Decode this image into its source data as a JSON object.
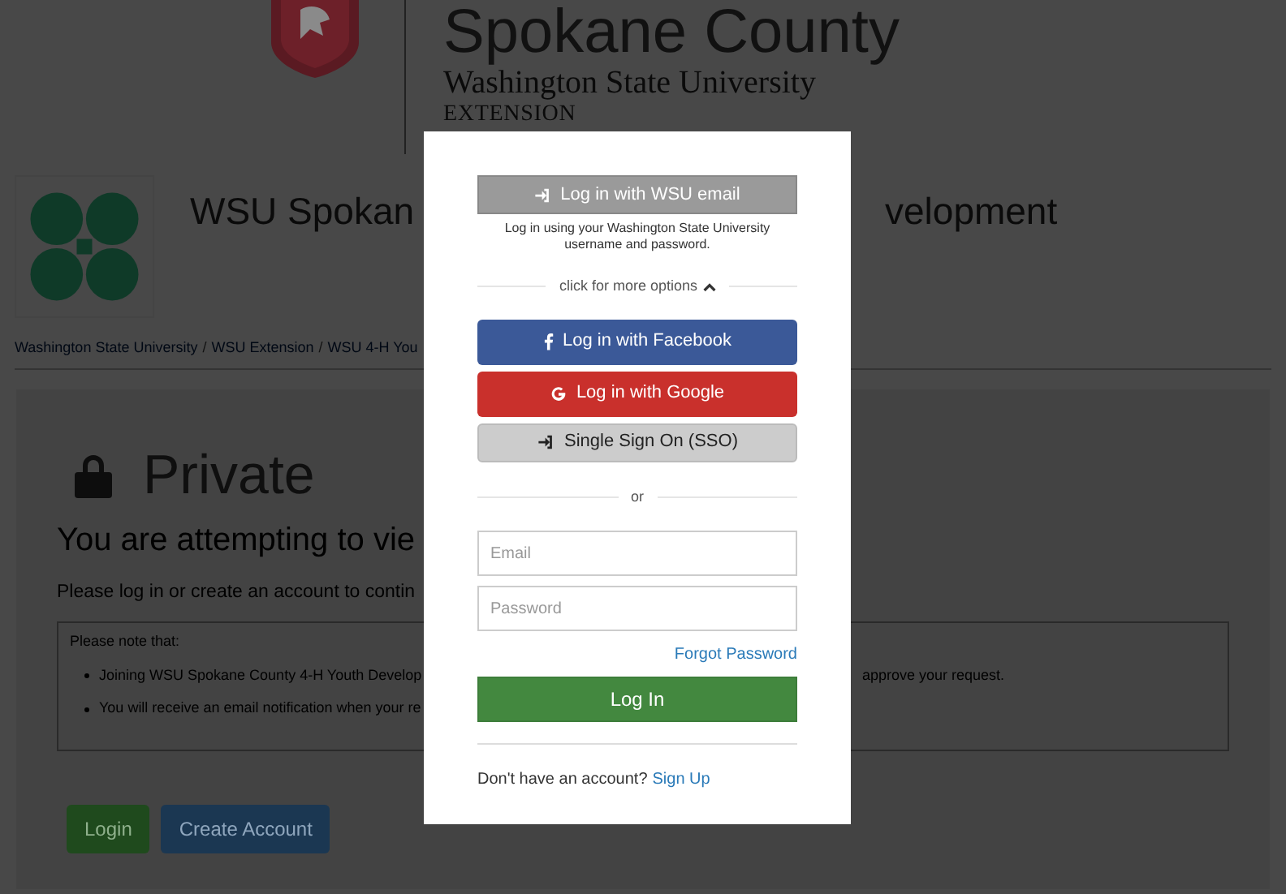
{
  "header": {
    "county_title": "Spokane County",
    "university": "Washington State University",
    "extension": "EXTENSION"
  },
  "site_title": {
    "left_part": "WSU Spokan",
    "right_part": "velopment"
  },
  "breadcrumbs": [
    {
      "label": "Washington State University"
    },
    {
      "separator": "/",
      "label": "WSU Extension"
    },
    {
      "separator": "/",
      "label": "WSU 4-H You"
    }
  ],
  "private_panel": {
    "heading": "Private",
    "subheading": "You are attempting to vie",
    "message": "Please log in or create an account to contin",
    "note": {
      "title": "Please note that:",
      "items": [
        {
          "left": "Joining WSU Spokane County 4-H Youth Develop",
          "right": "approve your request."
        },
        {
          "left": "You will receive an email notification when your re"
        }
      ]
    },
    "buttons": [
      {
        "label": "Login",
        "kind": "login"
      },
      {
        "label": "Create Account",
        "kind": "create"
      }
    ]
  },
  "login_modal": {
    "wsu_button": "Log in with WSU email",
    "wsu_help": "Log in using your Washington State University username and password.",
    "more_options": {
      "label": "click for more options",
      "expanded": true
    },
    "providers": [
      {
        "kind": "facebook",
        "label": "Log in with Facebook"
      },
      {
        "kind": "google",
        "label": "Log in with Google"
      },
      {
        "kind": "sso",
        "label": "Single Sign On (SSO)"
      }
    ],
    "separator": "or",
    "email": {
      "placeholder": "Email"
    },
    "password": {
      "placeholder": "Password"
    },
    "forgot_link": "Forgot Password",
    "submit": "Log In",
    "signup_prompt": "Don't have an account?",
    "signup_link": "Sign Up"
  }
}
